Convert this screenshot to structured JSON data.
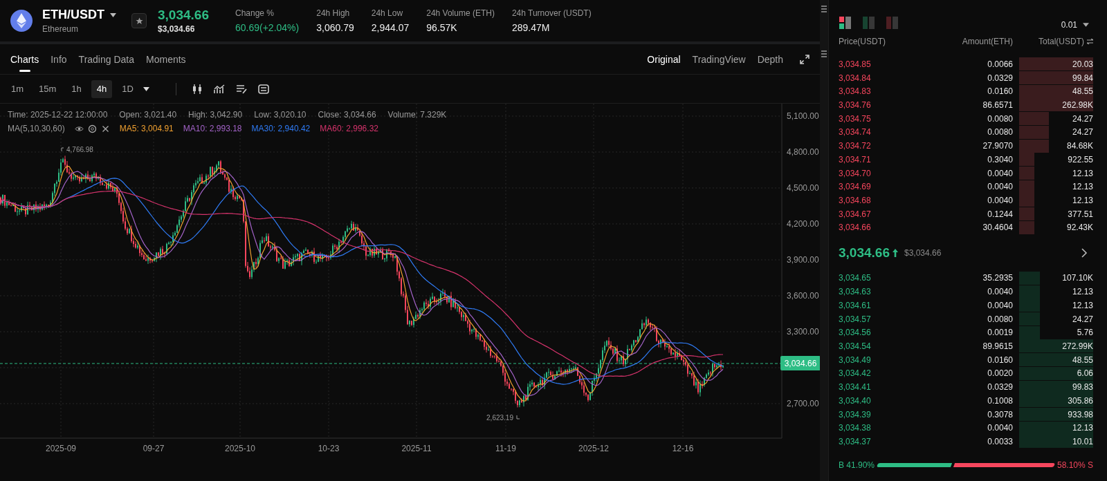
{
  "header": {
    "pair": "ETH/USDT",
    "name": "Ethereum",
    "price": "3,034.66",
    "price_usd": "$3,034.66",
    "stats": [
      {
        "label": "Change %",
        "value": "60.69(+2.04%)",
        "kind": "up"
      },
      {
        "label": "24h High",
        "value": "3,060.79",
        "kind": "plain"
      },
      {
        "label": "24h Low",
        "value": "2,944.07",
        "kind": "plain"
      },
      {
        "label": "24h Volume (ETH)",
        "value": "96.57K",
        "kind": "plain"
      },
      {
        "label": "24h Turnover (USDT)",
        "value": "289.47M",
        "kind": "plain"
      }
    ]
  },
  "tabs": [
    {
      "label": "Charts",
      "selected": true
    },
    {
      "label": "Info",
      "selected": false
    },
    {
      "label": "Trading Data",
      "selected": false
    },
    {
      "label": "Moments",
      "selected": false
    }
  ],
  "view_tabs": [
    {
      "label": "Original",
      "selected": true
    },
    {
      "label": "TradingView",
      "selected": false
    },
    {
      "label": "Depth",
      "selected": false
    }
  ],
  "intervals": [
    {
      "label": "1m",
      "selected": false,
      "dropdown": false
    },
    {
      "label": "15m",
      "selected": false,
      "dropdown": false
    },
    {
      "label": "1h",
      "selected": false,
      "dropdown": false
    },
    {
      "label": "4h",
      "selected": true,
      "dropdown": false
    },
    {
      "label": "1D",
      "selected": false,
      "dropdown": true
    }
  ],
  "chart": {
    "info": [
      "Time: 2025-12-22 12:00:00",
      "Open: 3,021.40",
      "High: 3,042.90",
      "Low: 3,020.10",
      "Close: 3,034.66",
      "Volume: 7.329K"
    ],
    "ma_label": "MA(5,10,30,60)",
    "ma": [
      {
        "text": "MA5: 3,004.91",
        "color": "#f0a030"
      },
      {
        "text": "MA10: 2,993.18",
        "color": "#a363c8"
      },
      {
        "text": "MA30: 2,940.42",
        "color": "#2f7bf5"
      },
      {
        "text": "MA60: 2,996.32",
        "color": "#d6336c"
      }
    ],
    "y_ticks": [
      "5,100.00",
      "4,800.00",
      "4,500.00",
      "4,200.00",
      "3,900.00",
      "3,600.00",
      "3,300.00",
      "2,700.00"
    ],
    "x_ticks": [
      "2025-09",
      "09-27",
      "2025-10",
      "10-23",
      "2025-11",
      "11-19",
      "2025-12",
      "12-16"
    ],
    "high_mark": "4,766.98",
    "low_mark": "2,623.19",
    "last_price": "3,034.66"
  },
  "order_book": {
    "modes": [
      {
        "kind": "both",
        "selected": true
      },
      {
        "kind": "bids",
        "selected": false
      },
      {
        "kind": "asks",
        "selected": false
      }
    ],
    "precision": "0.01",
    "columns": [
      "Price(USDT)",
      "Amount(ETH)",
      "Total(USDT)"
    ],
    "asks": [
      {
        "price": "3,034.85",
        "amount": "0.0066",
        "total": "20.03"
      },
      {
        "price": "3,034.84",
        "amount": "0.0329",
        "total": "99.84"
      },
      {
        "price": "3,034.83",
        "amount": "0.0160",
        "total": "48.55"
      },
      {
        "price": "3,034.76",
        "amount": "86.6571",
        "total": "262.98K"
      },
      {
        "price": "3,034.75",
        "amount": "0.0080",
        "total": "24.27"
      },
      {
        "price": "3,034.74",
        "amount": "0.0080",
        "total": "24.27"
      },
      {
        "price": "3,034.72",
        "amount": "27.9070",
        "total": "84.68K"
      },
      {
        "price": "3,034.71",
        "amount": "0.3040",
        "total": "922.55"
      },
      {
        "price": "3,034.70",
        "amount": "0.0040",
        "total": "12.13"
      },
      {
        "price": "3,034.69",
        "amount": "0.0040",
        "total": "12.13"
      },
      {
        "price": "3,034.68",
        "amount": "0.0040",
        "total": "12.13"
      },
      {
        "price": "3,034.67",
        "amount": "0.1244",
        "total": "377.51"
      },
      {
        "price": "3,034.66",
        "amount": "30.4604",
        "total": "92.43K"
      }
    ],
    "mid": {
      "price": "3,034.66",
      "usd": "$3,034.66"
    },
    "bids": [
      {
        "price": "3,034.65",
        "amount": "35.2935",
        "total": "107.10K"
      },
      {
        "price": "3,034.63",
        "amount": "0.0040",
        "total": "12.13"
      },
      {
        "price": "3,034.61",
        "amount": "0.0040",
        "total": "12.13"
      },
      {
        "price": "3,034.57",
        "amount": "0.0080",
        "total": "24.27"
      },
      {
        "price": "3,034.56",
        "amount": "0.0019",
        "total": "5.76"
      },
      {
        "price": "3,034.54",
        "amount": "89.9615",
        "total": "272.99K"
      },
      {
        "price": "3,034.49",
        "amount": "0.0160",
        "total": "48.55"
      },
      {
        "price": "3,034.42",
        "amount": "0.0020",
        "total": "6.06"
      },
      {
        "price": "3,034.41",
        "amount": "0.0329",
        "total": "99.83"
      },
      {
        "price": "3,034.40",
        "amount": "0.1008",
        "total": "305.86"
      },
      {
        "price": "3,034.39",
        "amount": "0.3078",
        "total": "933.98"
      },
      {
        "price": "3,034.38",
        "amount": "0.0040",
        "total": "12.13"
      },
      {
        "price": "3,034.37",
        "amount": "0.0033",
        "total": "10.01"
      }
    ],
    "ratio": {
      "buy": "B 41.90%",
      "sell": "58.10% S"
    }
  }
}
